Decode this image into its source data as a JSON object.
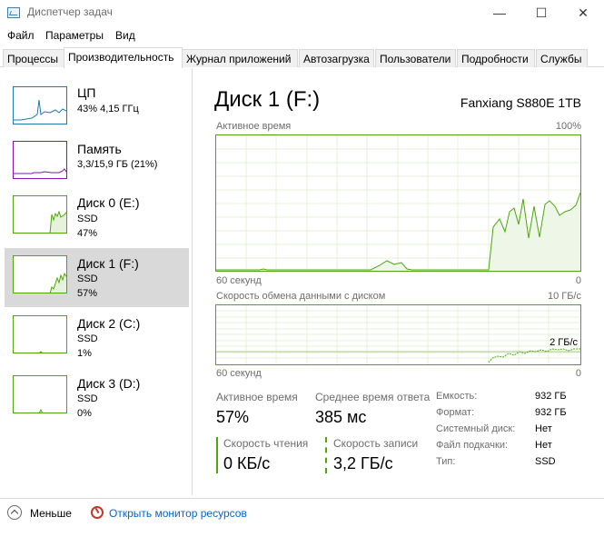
{
  "window": {
    "title": "Диспетчер задач",
    "min_glyph": "—",
    "max_glyph": "☐",
    "close_glyph": "✕"
  },
  "menu": [
    "Файл",
    "Параметры",
    "Вид"
  ],
  "tabs": [
    "Процессы",
    "Производительность",
    "Журнал приложений",
    "Автозагрузка",
    "Пользователи",
    "Подробности",
    "Службы"
  ],
  "active_tab": 1,
  "sidebar": {
    "cpu": {
      "name": "ЦП",
      "sub1": "43% 4,15 ГГц"
    },
    "memory": {
      "name": "Память",
      "sub1": "3,3/15,9 ГБ (21%)"
    },
    "disk0": {
      "name": "Диск 0 (E:)",
      "sub1": "SSD",
      "sub2": "47%"
    },
    "disk1": {
      "name": "Диск 1 (F:)",
      "sub1": "SSD",
      "sub2": "57%"
    },
    "disk2": {
      "name": "Диск 2 (C:)",
      "sub1": "SSD",
      "sub2": "1%"
    },
    "disk3": {
      "name": "Диск 3 (D:)",
      "sub1": "SSD",
      "sub2": "0%"
    }
  },
  "detail": {
    "title": "Диск 1 (F:)",
    "model": "Fanxiang S880E 1TB",
    "graph1": {
      "label": "Активное время",
      "max": "100%",
      "time_left": "60 секунд",
      "time_right": "0"
    },
    "graph2": {
      "label": "Скорость обмена данными с диском",
      "max": "10 ГБ/с",
      "inner_label": "2 ГБ/с",
      "time_left": "60 секунд",
      "time_right": "0"
    },
    "stats": {
      "active_time_label": "Активное время",
      "active_time_value": "57%",
      "avg_response_label": "Среднее время ответа",
      "avg_response_value": "385 мс",
      "read_speed_label": "Скорость чтения",
      "read_speed_value": "0 КБ/с",
      "write_speed_label": "Скорость записи",
      "write_speed_value": "3,2 ГБ/с"
    },
    "properties": [
      {
        "label": "Емкость:",
        "value": "932 ГБ"
      },
      {
        "label": "Формат:",
        "value": "932 ГБ"
      },
      {
        "label": "Системный диск:",
        "value": "Нет"
      },
      {
        "label": "Файл подкачки:",
        "value": "Нет"
      },
      {
        "label": "Тип:",
        "value": "SSD"
      }
    ]
  },
  "footer": {
    "fewer_label": "Меньше",
    "resource_monitor_label": "Открыть монитор ресурсов"
  },
  "colors": {
    "disk_accent": "#4da60c",
    "cpu_accent": "#1a7ab0",
    "memory_accent": "#8b12ae",
    "link": "#0066cc"
  }
}
